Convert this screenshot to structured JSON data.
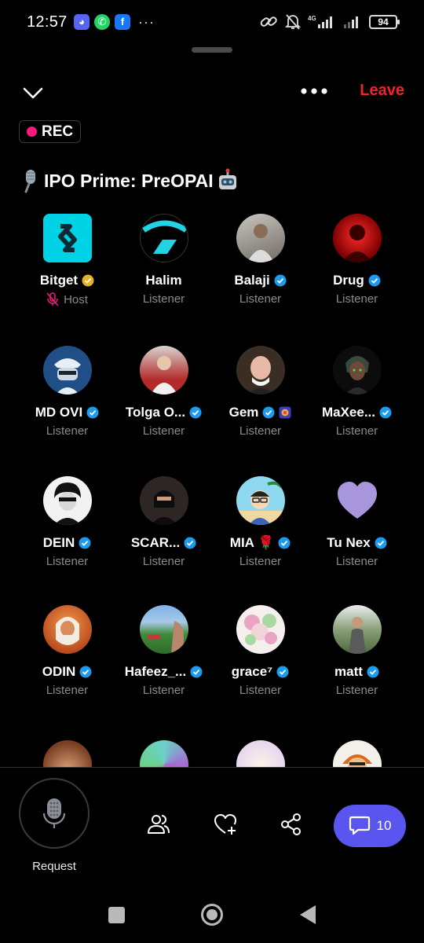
{
  "status_bar": {
    "time": "12:57",
    "more": "···",
    "network": "4G",
    "battery": "94"
  },
  "header": {
    "leave_label": "Leave",
    "rec_label": "REC",
    "title": "IPO Prime: PreOPAI"
  },
  "colors": {
    "background": "#000000",
    "leave_red": "#F4212E",
    "rec_pink": "#F91880",
    "verified_blue": "#1D9BF0",
    "gold_badge": "#E8B323",
    "chat_purple": "#5B55F0",
    "muted_text": "#8B8B8B"
  },
  "participants": [
    {
      "name": "Bitget",
      "role": "Host",
      "badge": "gold-check",
      "muted": true
    },
    {
      "name": "Halim",
      "role": "Listener",
      "badge": ""
    },
    {
      "name": "Balaji",
      "role": "Listener",
      "badge": "blue-check"
    },
    {
      "name": "Drug",
      "role": "Listener",
      "badge": "blue-check"
    },
    {
      "name": "MD OVI",
      "role": "Listener",
      "badge": "blue-check"
    },
    {
      "name": "Tolga O...",
      "role": "Listener",
      "badge": "blue-check"
    },
    {
      "name": "Gem",
      "role": "Listener",
      "badge": "blue-check"
    },
    {
      "name": "MaXee...",
      "role": "Listener",
      "badge": "blue-check"
    },
    {
      "name": "DEIN",
      "role": "Listener",
      "badge": "blue-check"
    },
    {
      "name": "SCAR...",
      "role": "Listener",
      "badge": "blue-check"
    },
    {
      "name": "MIA 🌹",
      "role": "Listener",
      "badge": "blue-check"
    },
    {
      "name": "Tu Nex",
      "role": "Listener",
      "badge": "blue-check"
    },
    {
      "name": "ODIN",
      "role": "Listener",
      "badge": "blue-check"
    },
    {
      "name": "Hafeez_...",
      "role": "Listener",
      "badge": "blue-check"
    },
    {
      "name": "grace⁷",
      "role": "Listener",
      "badge": "blue-check"
    },
    {
      "name": "matt",
      "role": "Listener",
      "badge": "blue-check"
    }
  ],
  "bottom_bar": {
    "request_label": "Request",
    "chat_count": "10",
    "icons": [
      "mic-icon",
      "people-icon",
      "heart-plus-icon",
      "share-icon",
      "chat-bubble-icon"
    ]
  }
}
